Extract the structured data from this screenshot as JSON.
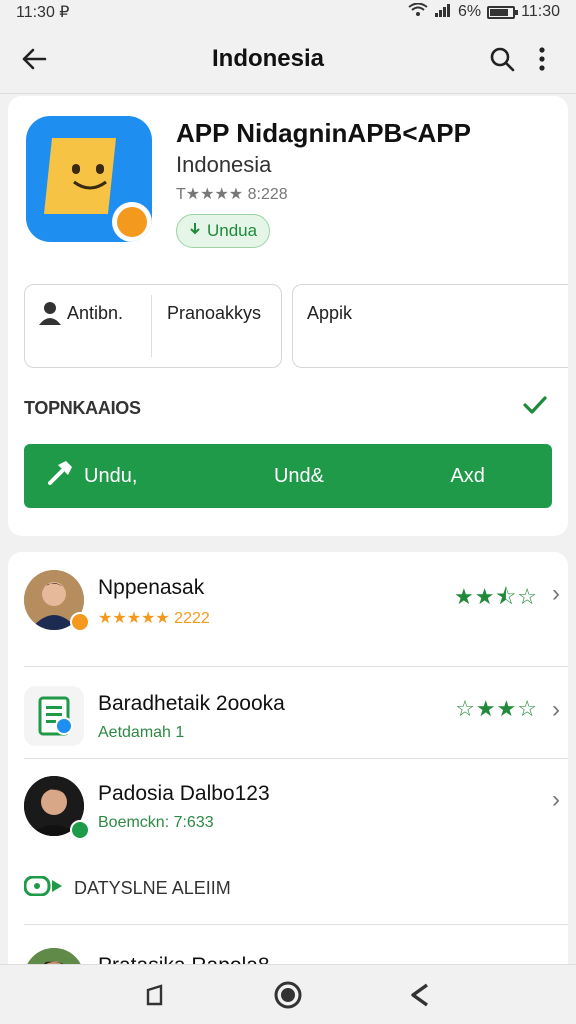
{
  "status": {
    "time_left": "11:30 ₽",
    "battery": "6%",
    "time_right": "11:30",
    "battery_level": 0.8
  },
  "appbar": {
    "title": "Indonesia"
  },
  "app": {
    "name": "APP NidagninAPB<APP",
    "subtitle": "Indonesia",
    "rating_text": "T★★★★ 8:228",
    "download_label": "Undua"
  },
  "info": {
    "box1_left": "Antibn.",
    "box1_right": "Pranoakkys",
    "box2": "Appik"
  },
  "section": {
    "label": "TOPNKAAIOS"
  },
  "action_bar": {
    "seg1": "Undu,",
    "seg2": "Und&",
    "seg3": "Axd"
  },
  "list": [
    {
      "title": "Nppenasak",
      "sub": "★★★★★ 2222",
      "stars": "★★⯪☆"
    },
    {
      "title": "Baradhetaik 2oooka",
      "sub": "Aetdamah 1",
      "stars": "☆★★☆"
    },
    {
      "title": "Padosia Dalbo123",
      "sub": "Boemckn: 7:633",
      "stars": ""
    }
  ],
  "subsection": {
    "label": "DATYSLNE ALEIIM"
  },
  "list_bottom": {
    "title": "Pratasika Rapola8",
    "stars": "★★⯪☆"
  },
  "colors": {
    "accent": "#1f9a48",
    "blue": "#1e8ff0",
    "orange": "#f39a1e"
  }
}
